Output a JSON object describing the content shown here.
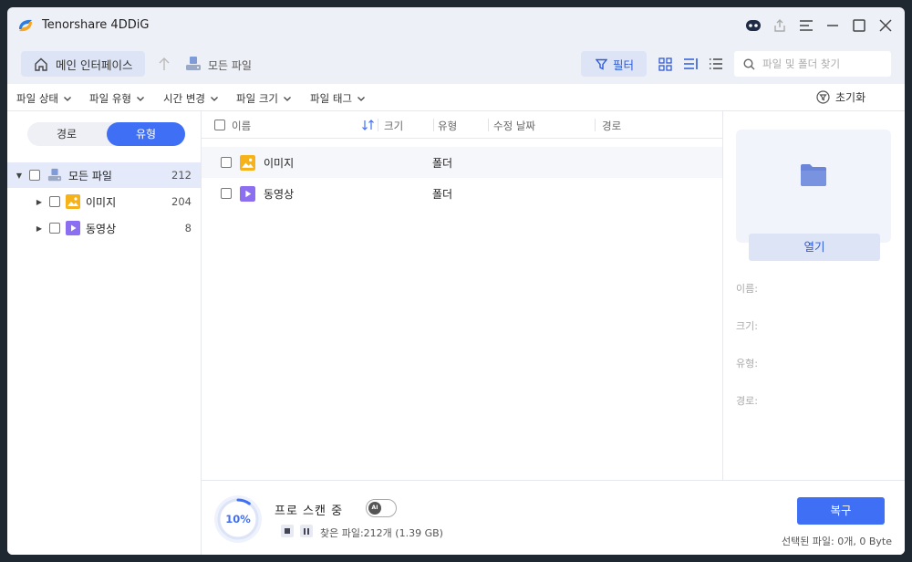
{
  "app": {
    "title": "Tenorshare 4DDiG"
  },
  "toolbar": {
    "home_label": "메인 인터페이스",
    "breadcrumb": "모든 파일",
    "filter_label": "필터",
    "search_placeholder": "파일 및 폴더 찾기"
  },
  "filters": {
    "items": [
      "파일 상태",
      "파일 유형",
      "시간 변경",
      "파일 크기",
      "파일 태그"
    ],
    "reset_label": "초기화"
  },
  "sidebar": {
    "tabs": [
      "경로",
      "유형"
    ],
    "active_tab": "유형",
    "tree": [
      {
        "label": "모든 파일",
        "count": "212",
        "selected": true
      },
      {
        "label": "이미지",
        "count": "204"
      },
      {
        "label": "동영상",
        "count": "8"
      }
    ]
  },
  "table": {
    "columns": [
      "이름",
      "크기",
      "유형",
      "수정 날짜",
      "경로"
    ],
    "rows": [
      {
        "name": "이미지",
        "size": "",
        "type": "폴더",
        "modified": "",
        "path": ""
      },
      {
        "name": "동영상",
        "size": "",
        "type": "폴더",
        "modified": "",
        "path": ""
      }
    ]
  },
  "details": {
    "open_label": "열기",
    "name_label": "이름:",
    "size_label": "크기:",
    "type_label": "유형:",
    "path_label": "경로:"
  },
  "scan": {
    "progress_percent": 10,
    "progress_text": "10%",
    "title": "프로 스캔 중",
    "ai_badge": "AI",
    "found_text": "찾은 파일:212개 (1.39 GB)"
  },
  "footer": {
    "recover_label": "복구",
    "selected_text": "선택된 파일: 0개, 0 Byte"
  },
  "colors": {
    "accent": "#3f6ff5",
    "image_icon": "#f5b21b",
    "video_icon": "#8c6ff0",
    "folder": "#6b86d8"
  }
}
